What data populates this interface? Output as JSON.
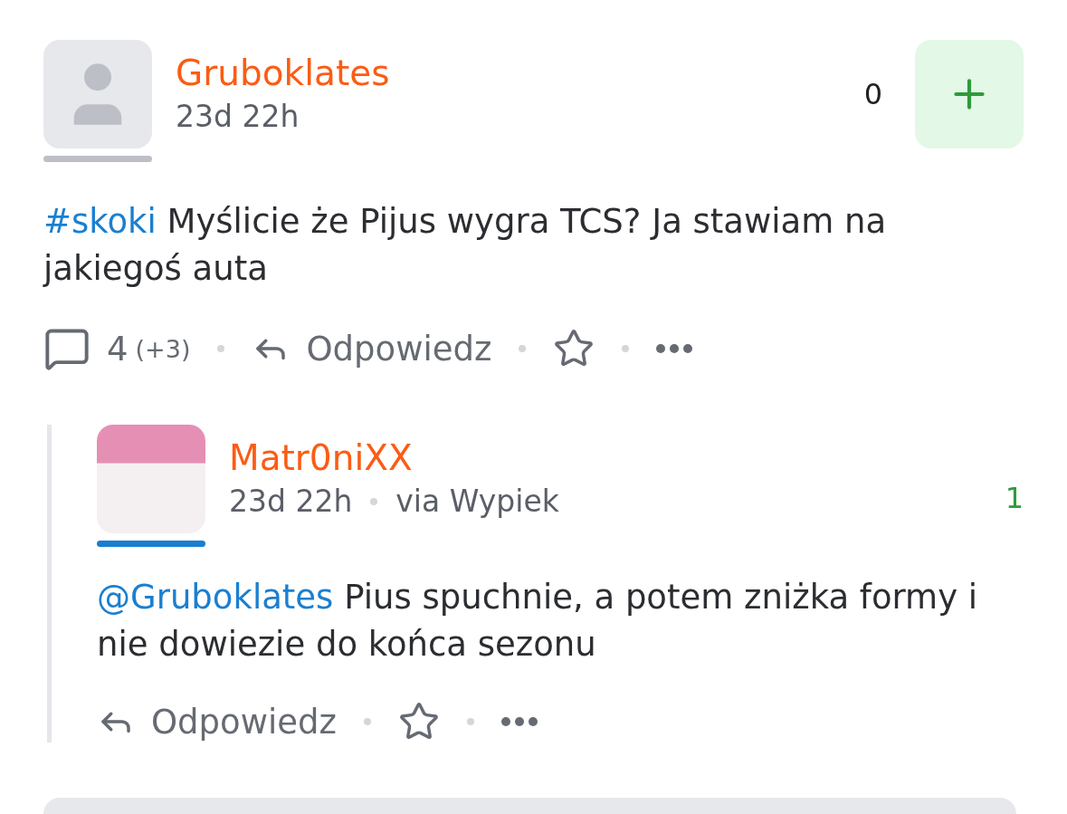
{
  "posts": [
    {
      "kind": "post",
      "author": "Gruboklates",
      "time": "23d 22h",
      "color": "#bcbfc6",
      "score": "0",
      "body": [
        {
          "kind": "link",
          "text": "#skoki"
        },
        {
          "kind": "text",
          "text": " Myślicie że Pijus wygra TCS? Ja stawiam na jakiegoś auta"
        }
      ],
      "comments": "4",
      "new_comments": "(+3)",
      "reply": "Odpowiedz"
    },
    {
      "kind": "reply",
      "author": "Matr0niXX",
      "time": "23d 22h",
      "via": "via Wypiek",
      "color": "#1a7fd0",
      "score": "1",
      "body": [
        {
          "kind": "link",
          "text": "@Gruboklates"
        },
        {
          "kind": "text",
          "text": " Pius spuchnie, a potem zniżka formy i nie dowiezie do końca sezonu"
        }
      ],
      "reply": "Odpowiedz"
    }
  ]
}
